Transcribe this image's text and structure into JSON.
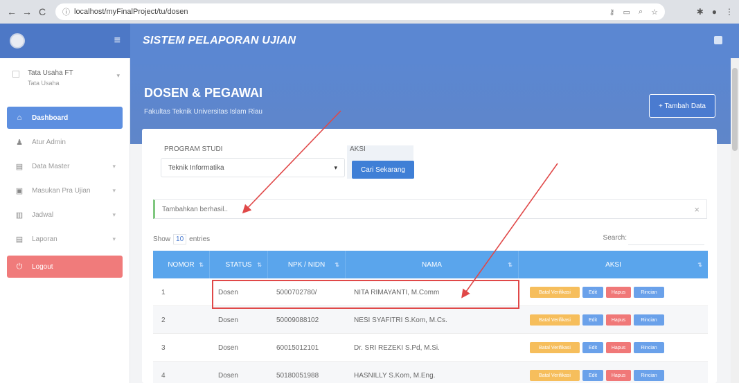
{
  "browser": {
    "url": "localhost/myFinalProject/tu/dosen",
    "back_icon": "arrow-left",
    "forward_icon": "arrow-right",
    "reload_icon": "reload"
  },
  "header": {
    "app_title": "SISTEM PELAPORAN UJIAN"
  },
  "sidebar": {
    "user_name": "Tata Usaha FT",
    "user_role": "Tata Usaha",
    "items": [
      {
        "label": "Dashboard",
        "icon": "home",
        "active": true
      },
      {
        "label": "Atur Admin",
        "icon": "user"
      },
      {
        "label": "Data Master",
        "icon": "database"
      },
      {
        "label": "Masukan Pra Ujian",
        "icon": "id-card"
      },
      {
        "label": "Jadwal",
        "icon": "calendar"
      },
      {
        "label": "Laporan",
        "icon": "file"
      }
    ],
    "logout_label": "Logout"
  },
  "page": {
    "title": "DOSEN & PEGAWAI",
    "subtitle": "Fakultas Teknik Universitas Islam Riau",
    "add_button": "+ Tambah Data"
  },
  "filter": {
    "prodi_label": "PROGRAM STUDI",
    "prodi_value": "Teknik Informatika",
    "aksi_label": "AKSI",
    "search_button": "Cari Sekarang"
  },
  "alert": {
    "message": "Tambahkan berhasil..",
    "close": "×"
  },
  "table_controls": {
    "show": "Show",
    "length": "10",
    "entries": "entries",
    "search_label": "Search:"
  },
  "table": {
    "columns": [
      "NOMOR",
      "STATUS",
      "NPK / NIDN",
      "NAMA",
      "AKSI"
    ],
    "rows": [
      {
        "no": "1",
        "status": "Dosen",
        "npk": "5000702780/",
        "nama": "NITA RIMAYANTI, M.Comm"
      },
      {
        "no": "2",
        "status": "Dosen",
        "npk": "50009088102",
        "nama": "NESI SYAFITRI S.Kom, M.Cs."
      },
      {
        "no": "3",
        "status": "Dosen",
        "npk": "60015012101",
        "nama": "Dr. SRI REZEKI S.Pd, M.Si."
      },
      {
        "no": "4",
        "status": "Dosen",
        "npk": "50180051988",
        "nama": "HASNILLY S.Kom, M.Eng."
      }
    ],
    "action_labels": {
      "verify": "Batal Verifikasi",
      "edit": "Edit",
      "delete": "Hapus",
      "check": "Rincian"
    }
  },
  "colors": {
    "primary": "#5b87d2",
    "table_head": "#5aa5ec",
    "logout": "#f07b7b",
    "highlight": "#e04848"
  }
}
